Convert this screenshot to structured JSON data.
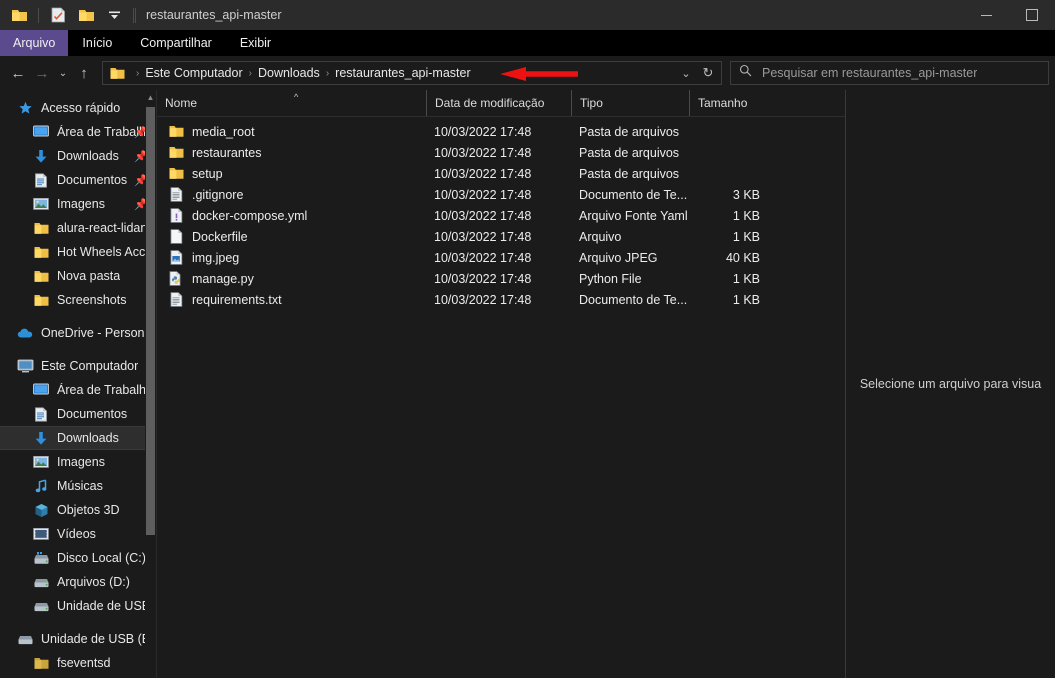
{
  "window": {
    "title": "restaurantes_api-master",
    "controls": {
      "minimize": "—",
      "maximize": "▢"
    },
    "quick_access": [
      "folder-icon",
      "checklist-icon",
      "folder-icon",
      "chevron-down-icon"
    ]
  },
  "ribbon": {
    "tabs": [
      {
        "label": "Arquivo",
        "active": true
      },
      {
        "label": "Início",
        "active": false
      },
      {
        "label": "Compartilhar",
        "active": false
      },
      {
        "label": "Exibir",
        "active": false
      }
    ],
    "accent_color": "#5c4a8f"
  },
  "addressbar": {
    "back": "←",
    "forward": "→",
    "recent": "⌄",
    "up": "↑",
    "breadcrumb": [
      "Este Computador",
      "Downloads",
      "restaurantes_api-master"
    ],
    "dropdown": "⌄",
    "refresh": "↻"
  },
  "search": {
    "placeholder": "Pesquisar em restaurantes_api-master",
    "icon": "search-icon"
  },
  "sidebar": {
    "sections": [
      {
        "header": {
          "label": "Acesso rápido",
          "icon": "star-icon"
        },
        "items": [
          {
            "label": "Área de Trabalho",
            "icon": "desktop-icon",
            "pinned": true
          },
          {
            "label": "Downloads",
            "icon": "download-icon",
            "pinned": true
          },
          {
            "label": "Documentos",
            "icon": "documents-icon",
            "pinned": true
          },
          {
            "label": "Imagens",
            "icon": "pictures-icon",
            "pinned": true
          },
          {
            "label": "alura-react-lidando-",
            "icon": "folder-icon",
            "pinned": false
          },
          {
            "label": "Hot Wheels AcceleR",
            "icon": "folder-icon",
            "pinned": false
          },
          {
            "label": "Nova pasta",
            "icon": "folder-icon",
            "pinned": false
          },
          {
            "label": "Screenshots",
            "icon": "folder-icon",
            "pinned": false
          }
        ]
      },
      {
        "header": {
          "label": "OneDrive - Personal",
          "icon": "cloud-icon"
        },
        "items": []
      },
      {
        "header": {
          "label": "Este Computador",
          "icon": "computer-icon"
        },
        "items": [
          {
            "label": "Área de Trabalho",
            "icon": "desktop-icon",
            "selected": false
          },
          {
            "label": "Documentos",
            "icon": "documents-icon",
            "selected": false
          },
          {
            "label": "Downloads",
            "icon": "download-icon",
            "selected": true
          },
          {
            "label": "Imagens",
            "icon": "pictures-icon",
            "selected": false
          },
          {
            "label": "Músicas",
            "icon": "music-icon",
            "selected": false
          },
          {
            "label": "Objetos 3D",
            "icon": "objects3d-icon",
            "selected": false
          },
          {
            "label": "Vídeos",
            "icon": "videos-icon",
            "selected": false
          },
          {
            "label": "Disco Local (C:)",
            "icon": "harddisk-icon",
            "selected": false
          },
          {
            "label": "Arquivos (D:)",
            "icon": "drive-icon",
            "selected": false
          },
          {
            "label": "Unidade de USB (E:)",
            "icon": "drive-icon",
            "selected": false
          }
        ]
      },
      {
        "header": {
          "label": "Unidade de USB (E:)",
          "icon": "drive-icon"
        },
        "items": [
          {
            "label": "fseventsd",
            "icon": "folder-icon",
            "selected": false
          }
        ]
      }
    ]
  },
  "filelist": {
    "columns": [
      {
        "label": "Nome",
        "sorted": "asc"
      },
      {
        "label": "Data de modificação",
        "sorted": ""
      },
      {
        "label": "Tipo",
        "sorted": ""
      },
      {
        "label": "Tamanho",
        "sorted": ""
      }
    ],
    "rows": [
      {
        "name": "media_root",
        "icon": "folder-icon",
        "date": "10/03/2022 17:48",
        "type": "Pasta de arquivos",
        "size": ""
      },
      {
        "name": "restaurantes",
        "icon": "folder-icon",
        "date": "10/03/2022 17:48",
        "type": "Pasta de arquivos",
        "size": ""
      },
      {
        "name": "setup",
        "icon": "folder-icon",
        "date": "10/03/2022 17:48",
        "type": "Pasta de arquivos",
        "size": ""
      },
      {
        "name": ".gitignore",
        "icon": "textfile-icon",
        "date": "10/03/2022 17:48",
        "type": "Documento de Te...",
        "size": "3 KB"
      },
      {
        "name": "docker-compose.yml",
        "icon": "yaml-icon",
        "date": "10/03/2022 17:48",
        "type": "Arquivo Fonte Yaml",
        "size": "1 KB"
      },
      {
        "name": "Dockerfile",
        "icon": "blankfile-icon",
        "date": "10/03/2022 17:48",
        "type": "Arquivo",
        "size": "1 KB"
      },
      {
        "name": "img.jpeg",
        "icon": "jpeg-icon",
        "date": "10/03/2022 17:48",
        "type": "Arquivo JPEG",
        "size": "40 KB"
      },
      {
        "name": "manage.py",
        "icon": "python-icon",
        "date": "10/03/2022 17:48",
        "type": "Python File",
        "size": "1 KB"
      },
      {
        "name": "requirements.txt",
        "icon": "textfile-icon",
        "date": "10/03/2022 17:48",
        "type": "Documento de Te...",
        "size": "1 KB"
      }
    ]
  },
  "preview": {
    "message": "Selecione um arquivo para visua"
  },
  "annotation": {
    "arrow_color": "#ee1111",
    "direction": "left"
  }
}
